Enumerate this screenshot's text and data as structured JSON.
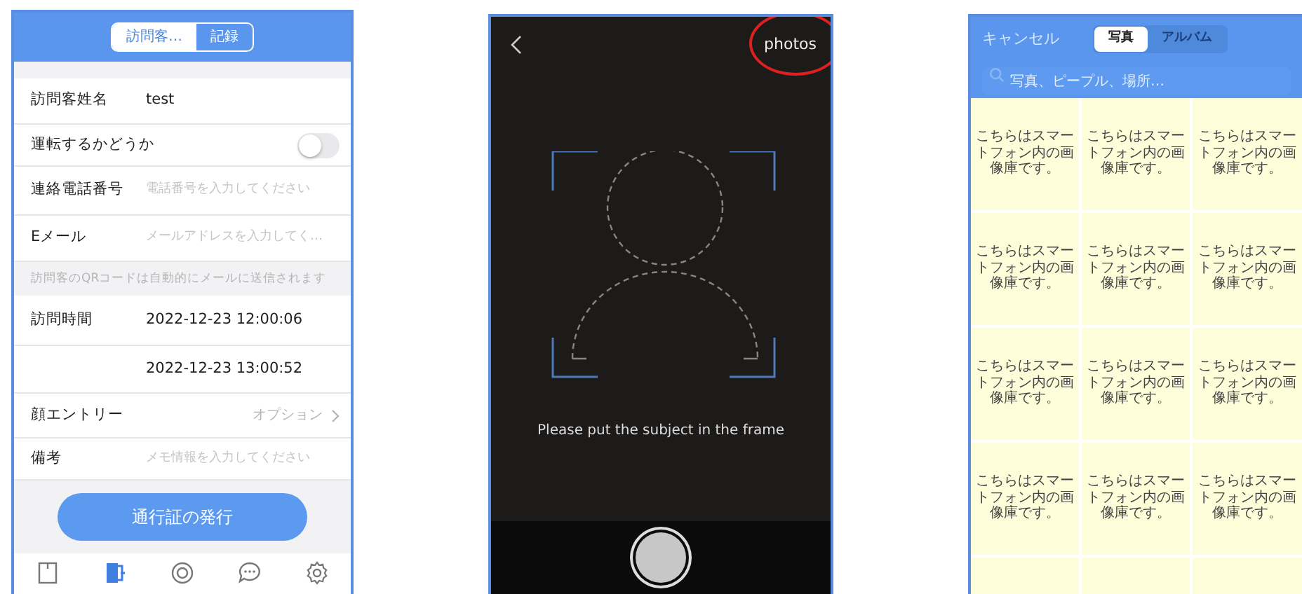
{
  "visitor_form": {
    "segments": [
      {
        "label": "訪問客…",
        "selected": true
      },
      {
        "label": "記録",
        "selected": false
      }
    ],
    "rows": [
      {
        "kind": "text",
        "label": "訪問客姓名",
        "value": "test"
      },
      {
        "kind": "toggle",
        "label": "運転するかどうか",
        "on": false
      },
      {
        "kind": "input",
        "label": "連絡電話番号",
        "placeholder": "電話番号を入力してください"
      },
      {
        "kind": "input",
        "label": "Eメール",
        "placeholder": "メールアドレスを入力してく…"
      },
      {
        "kind": "note",
        "label": "訪問客のQRコードは自動的にメールに送信されます"
      },
      {
        "kind": "text",
        "label": "訪問時間",
        "value": "2022-12-23 12:00:06"
      },
      {
        "kind": "text",
        "value": "2022-12-23 13:00:52"
      },
      {
        "kind": "link",
        "label": "顔エントリー",
        "value": "オプション"
      },
      {
        "kind": "input",
        "label": "備考",
        "placeholder": "メモ情報を入力してください"
      }
    ],
    "submit_button": "通行証の発行",
    "tab_bar": [
      {
        "kind": "record",
        "selected": false
      },
      {
        "kind": "door",
        "selected": true
      },
      {
        "kind": "target",
        "selected": false
      },
      {
        "kind": "chat",
        "selected": false
      },
      {
        "kind": "gear",
        "selected": false
      }
    ]
  },
  "camera": {
    "photos_link": "photos",
    "hint": "Please put the subject in the frame"
  },
  "photo_picker": {
    "cancel": "キャンセル",
    "segments": [
      {
        "label": "写真",
        "selected": true
      },
      {
        "label": "アルバム",
        "selected": false
      }
    ],
    "search": {
      "placeholder": "写真、ピープル、場所…"
    },
    "cells": [
      {
        "kind": "label",
        "text": "こちらはスマートフォン内の画像庫です。"
      },
      {
        "kind": "label",
        "text": "こちらはスマートフォン内の画像庫です。"
      },
      {
        "kind": "label",
        "text": "こちらはスマートフォン内の画像庫です。"
      },
      {
        "kind": "label",
        "text": "こちらはスマートフォン内の画像庫です。"
      },
      {
        "kind": "label",
        "text": "こちらはスマートフォン内の画像庫です。"
      },
      {
        "kind": "label",
        "text": "こちらはスマートフォン内の画像庫です。"
      },
      {
        "kind": "label",
        "text": "こちらはスマートフォン内の画像庫です。"
      },
      {
        "kind": "label",
        "text": "こちらはスマートフォン内の画像庫です。"
      },
      {
        "kind": "label",
        "text": "こちらはスマートフォン内の画像庫です。"
      },
      {
        "kind": "label",
        "text": "こちらはスマートフォン内の画像庫です。"
      },
      {
        "kind": "label",
        "text": "こちらはスマートフォン内の画像庫です。"
      },
      {
        "kind": "label",
        "text": "こちらはスマートフォン内の画像庫です。"
      },
      {
        "kind": "blank"
      },
      {
        "kind": "blank"
      },
      {
        "kind": "blank"
      }
    ]
  }
}
